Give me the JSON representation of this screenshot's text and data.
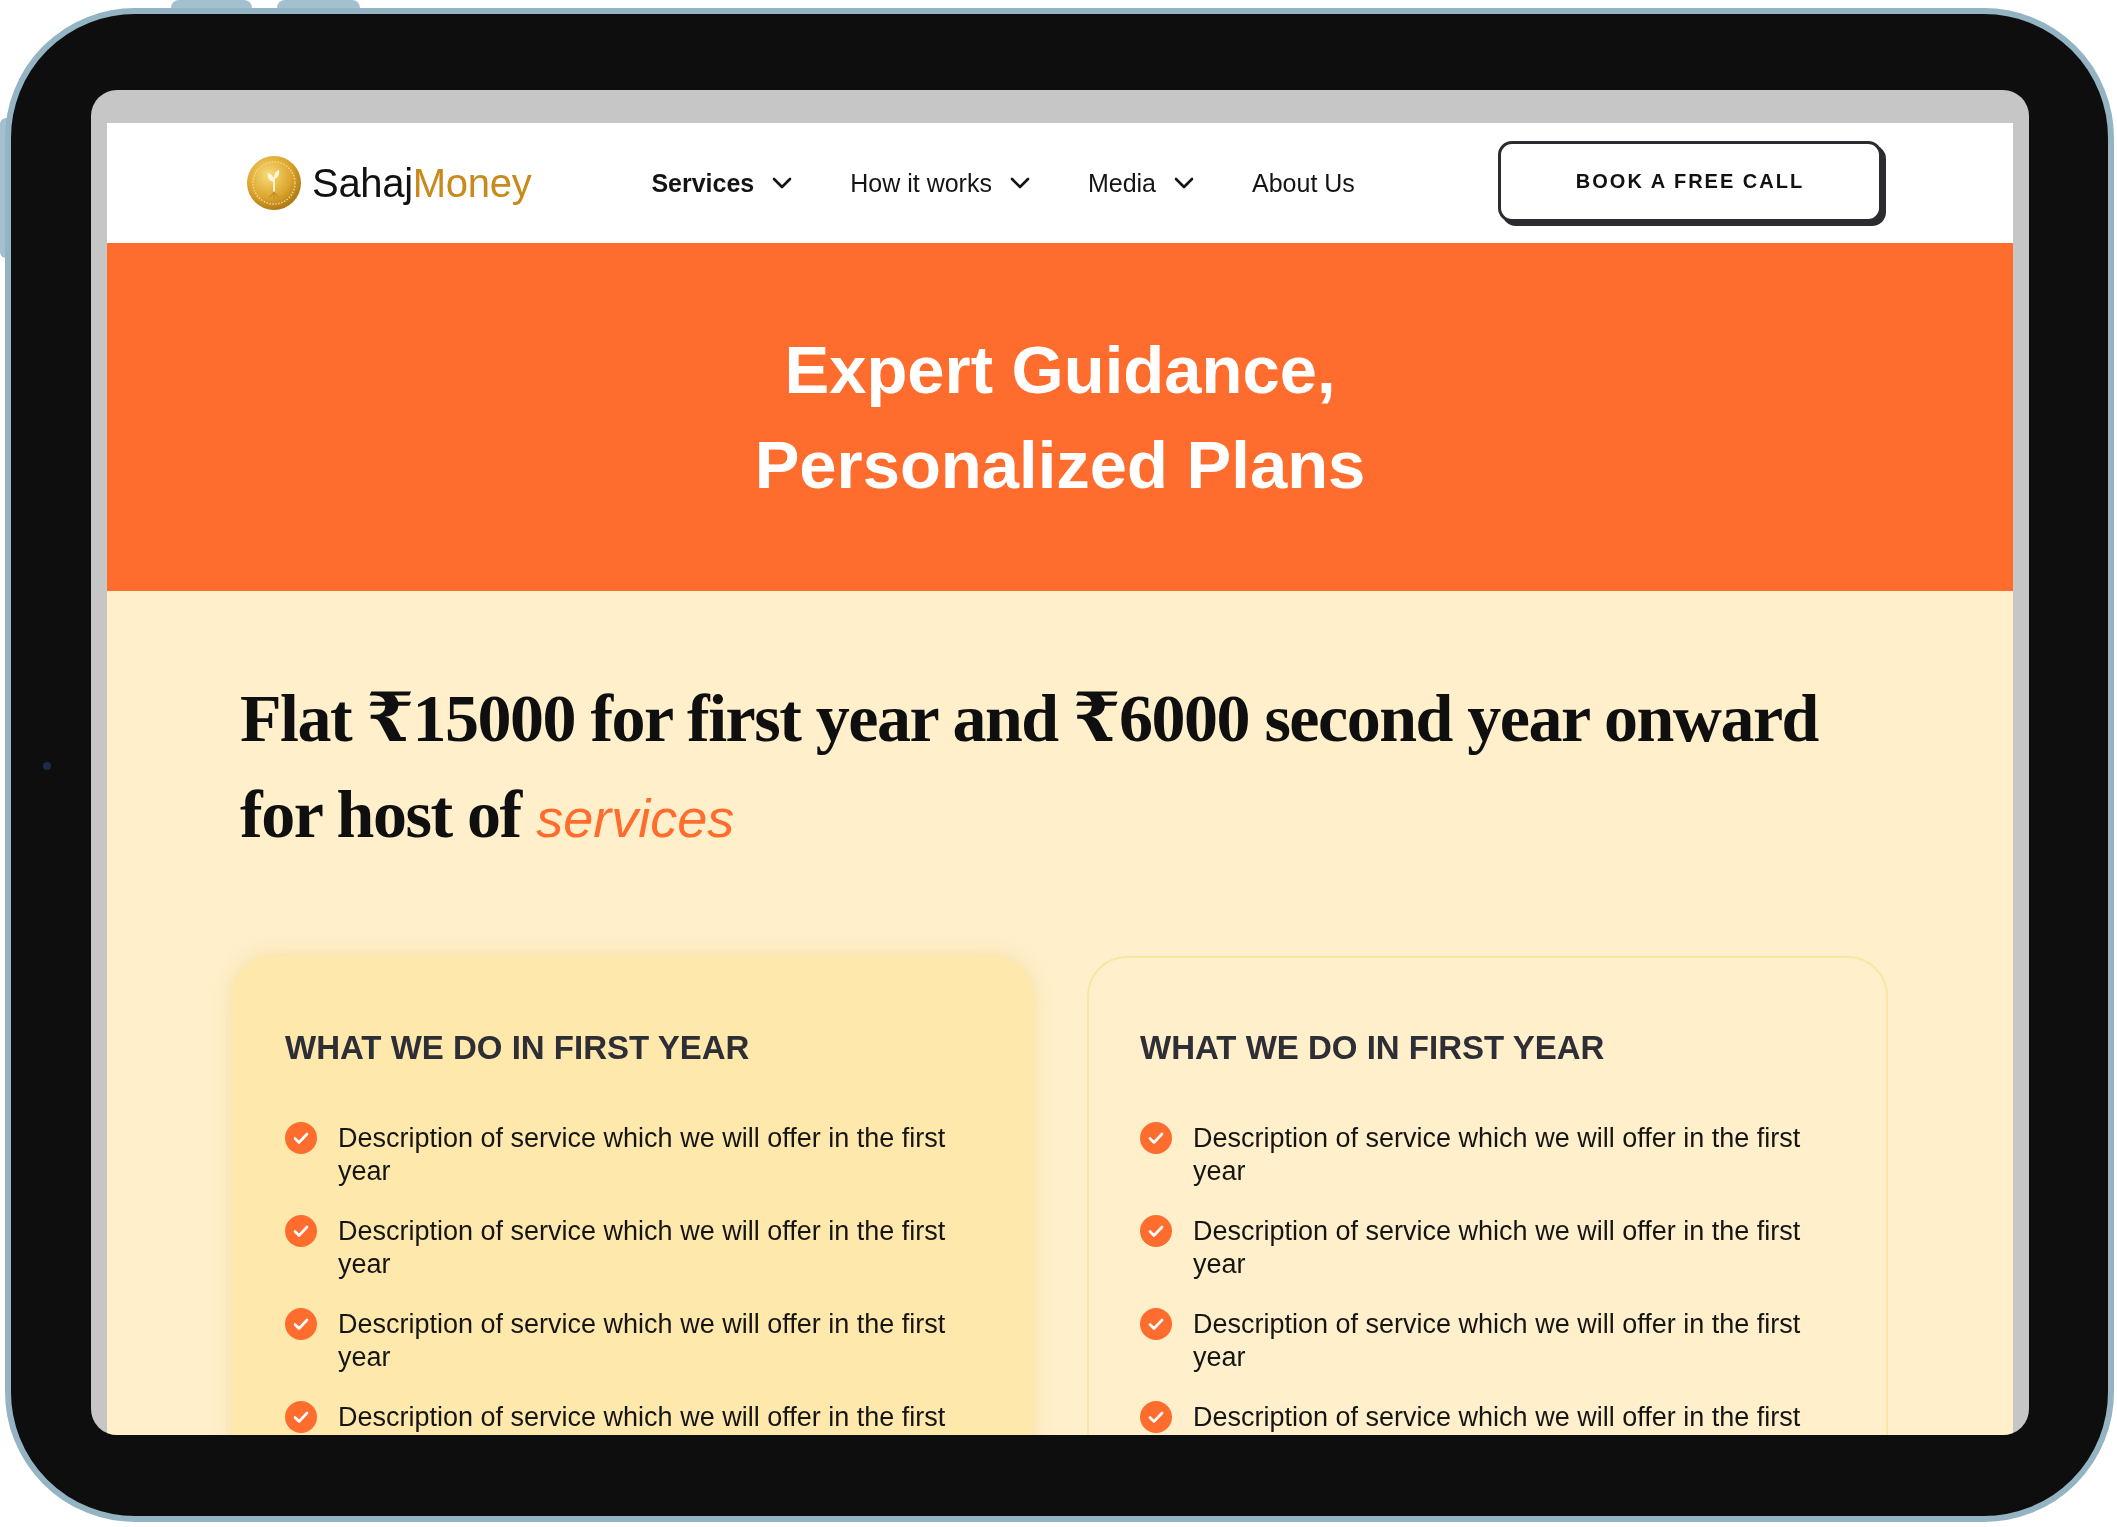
{
  "logo": {
    "name_first": "Sahaj",
    "name_second": "Money"
  },
  "nav": {
    "items": [
      {
        "label": "Services",
        "selected": true,
        "has_dropdown": true
      },
      {
        "label": "How it works",
        "selected": false,
        "has_dropdown": true
      },
      {
        "label": "Media",
        "selected": false,
        "has_dropdown": true
      },
      {
        "label": "About Us",
        "selected": false,
        "has_dropdown": false
      }
    ],
    "cta": "BOOK A FREE CALL"
  },
  "hero": {
    "title": "Expert Guidance, Personalized Plans"
  },
  "pricing": {
    "heading": "Flat ₹15000 for first year and ₹6000 second year onward for host of *services*",
    "cards": [
      {
        "title": "WHAT WE DO IN FIRST YEAR",
        "highlighted": true,
        "items": [
          "Description of service which we will offer in the first year",
          "Description of service which we will offer in the first year",
          "Description of service which we will offer in the first year",
          "Description of service which we will offer in the first"
        ]
      },
      {
        "title": "WHAT WE DO IN FIRST YEAR",
        "highlighted": false,
        "items": [
          "Description of service which we will offer in the first year",
          "Description of service which we will offer in the first year",
          "Description of service which we will offer in the first year",
          "Description of service which we will offer in the first"
        ]
      }
    ]
  }
}
